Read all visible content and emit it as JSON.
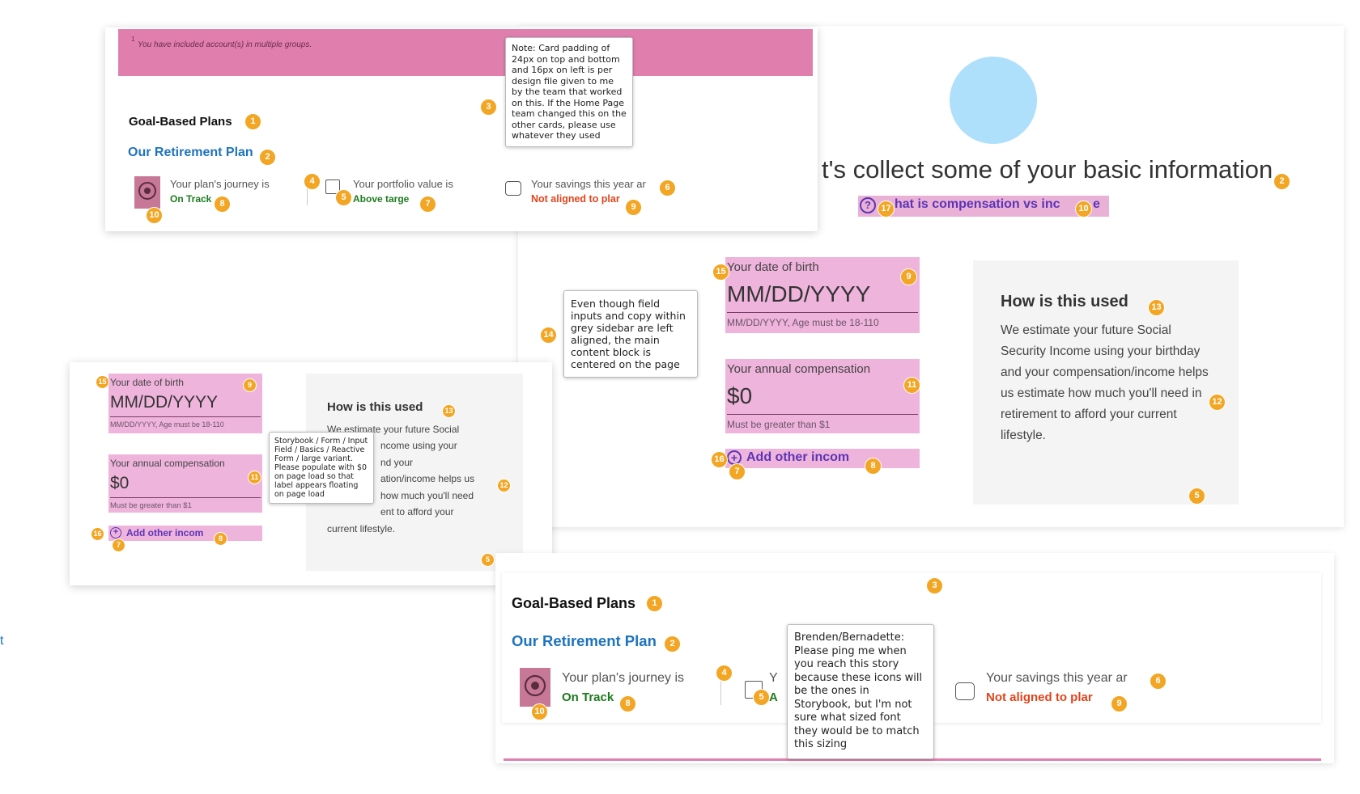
{
  "colors": {
    "accent": "#f2a623",
    "link_blue": "#1e73be",
    "on_track_green": "#1d7a1d",
    "not_aligned_red": "#e2441c",
    "banner_pink": "#e07fae",
    "field_pink": "#efb4dc",
    "avatar_blue": "#aee0fb"
  },
  "icons": [
    "target-icon",
    "portfolio-icon",
    "savings-icon",
    "help-circle-icon",
    "add-circle-icon"
  ],
  "top_card": {
    "banner_superscript": "1",
    "banner_text": "You have included account(s) in multiple groups.",
    "title": "Goal-Based Plans",
    "plan_name": "Our Retirement Plan",
    "journey_label": "Your plan's journey is",
    "journey_status": "On Track",
    "portfolio_label": "Your portfolio value is",
    "portfolio_status": "Above targe",
    "savings_label": "Your savings this year ar",
    "savings_status": "Not aligned to plar",
    "note": "Note: Card padding of 24px on top and bottom and 16px on left is per design file given to me by the team that worked on this. If the Home Page team changed this on the other cards, please use whatever they used"
  },
  "right_panel": {
    "heading": "t's collect some of your basic information",
    "help_link": "hat is compensation vs inc",
    "help_link_tail": "e",
    "dob_label": "Your date of birth",
    "dob_value": "MM/DD/YYYY",
    "dob_hint": "MM/DD/YYYY, Age must be 18-110",
    "comp_label": "Your annual compensation",
    "comp_value": "$0",
    "comp_hint": "Must be greater than $1",
    "add_income": "Add other incom",
    "sidebar_title": "How is this used",
    "sidebar_text": "We estimate your future Social Security Income using your birthday and your compensation/income helps us estimate how much you'll need in retirement to afford your current lifestyle.",
    "note": "Even though field inputs and copy within grey sidebar are left aligned, the main content block is centered on the page"
  },
  "left_panel": {
    "dob_label": "Your date of birth",
    "dob_value": "MM/DD/YYYY",
    "dob_hint": "MM/DD/YYYY, Age must be 18-110",
    "comp_label": "Your annual compensation",
    "comp_value": "$0",
    "comp_hint": "Must be greater than $1",
    "add_income": "Add other incom",
    "sidebar_title": "How is this used",
    "sidebar_lines": [
      "We estimate your future Social",
      "ncome using your",
      "nd your",
      "ation/income helps us",
      "how much you'll need",
      "ent to afford your",
      "current lifestyle."
    ],
    "note": "Storybook / Form / Input Field / Basics / Reactive Form / large variant. Please populate with $0 on page load so that label appears floating on page load"
  },
  "bottom_card": {
    "title": "Goal-Based Plans",
    "plan_name": "Our Retirement Plan",
    "journey_label": "Your plan's journey is",
    "journey_status": "On Track",
    "portfolio_label": "Y",
    "portfolio_status": "A",
    "savings_label": "Your savings this year ar",
    "savings_status": "Not aligned to plar",
    "note": "Brenden/Bernadette: Please ping me when you reach this story because these icons will be the ones in Storybook, but I'm not sure what sized font they would be to match this sizing"
  },
  "edge_fragment": "t",
  "badges": {
    "b1": "1",
    "b2": "2",
    "b3": "3",
    "b4": "4",
    "b5": "5",
    "b6": "6",
    "b7": "7",
    "b8": "8",
    "b9": "9",
    "b10": "10",
    "b11": "11",
    "b12": "12",
    "b13": "13",
    "b14": "14",
    "b15": "15",
    "b16": "16",
    "b17": "17"
  }
}
